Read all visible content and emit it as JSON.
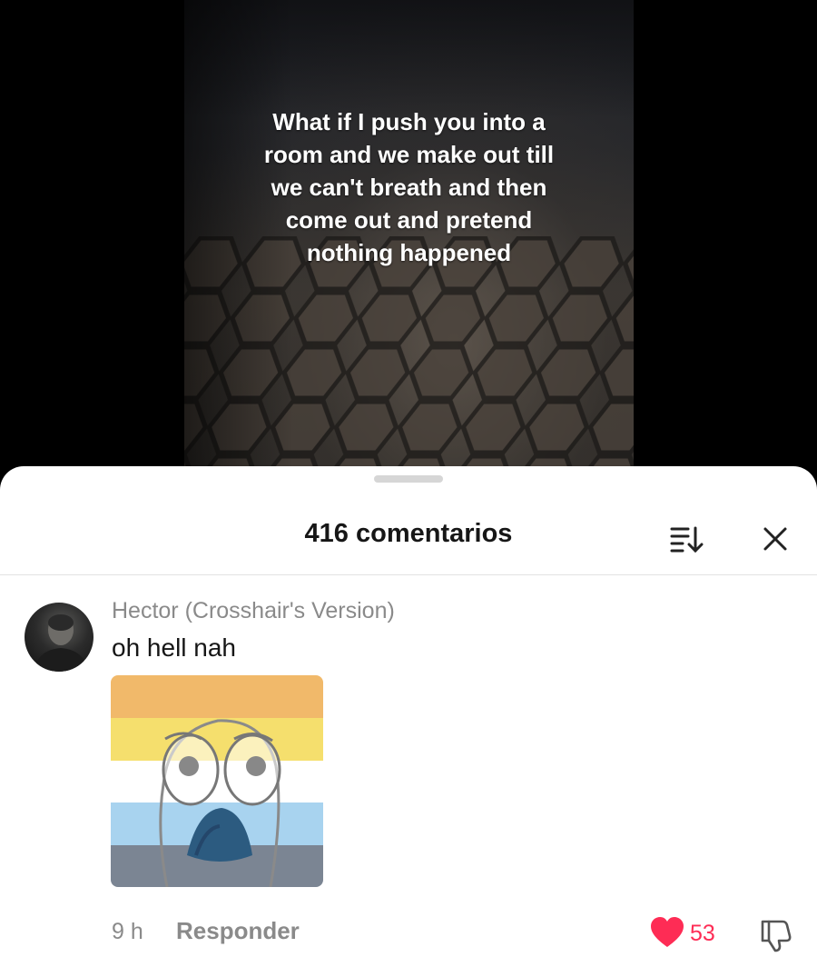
{
  "video": {
    "caption": "What if I push you into a\nroom and we make out till\nwe can't breath and then\ncome out and pretend\nnothing happened"
  },
  "comments_panel": {
    "title": "416 comentarios",
    "sort_icon": "sort-descending-icon",
    "close_icon": "close-icon"
  },
  "comment": {
    "username": "Hector (Crosshair's Version)",
    "text": "oh hell nah",
    "sticker": {
      "description_icon": "shocked-face-sticker",
      "stripe_colors": [
        "#f1b96a",
        "#f5df6d",
        "#ffffff",
        "#a8d3ef",
        "#7b8593"
      ]
    },
    "time": "9 h",
    "reply_label": "Responder",
    "likes": "53",
    "like_color": "#fe2c55",
    "dislike_icon": "thumbs-down-icon"
  }
}
